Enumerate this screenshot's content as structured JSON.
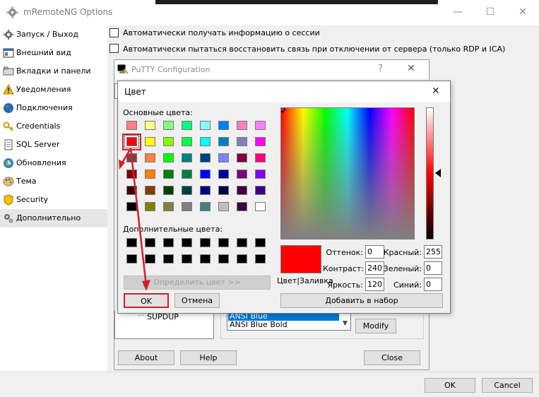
{
  "main": {
    "title": "mRemoteNG Options",
    "minimize": "—",
    "maximize": "☐",
    "close": "✕",
    "ok_label": "OK",
    "cancel_label": "Cancel"
  },
  "sidebar": {
    "items": [
      {
        "label": "Запуск / Выход",
        "icon": "gear-icon"
      },
      {
        "label": "Внешний вид",
        "icon": "window-icon"
      },
      {
        "label": "Вкладки и панели",
        "icon": "tabs-icon"
      },
      {
        "label": "Уведомления",
        "icon": "warning-icon"
      },
      {
        "label": "Подключения",
        "icon": "globe-icon"
      },
      {
        "label": "Credentials",
        "icon": "key-icon"
      },
      {
        "label": "SQL Server",
        "icon": "document-icon"
      },
      {
        "label": "Обновления",
        "icon": "update-icon"
      },
      {
        "label": "Тема",
        "icon": "palette-icon"
      },
      {
        "label": "Security",
        "icon": "shield-icon"
      },
      {
        "label": "Дополнительно",
        "icon": "gears-icon"
      }
    ]
  },
  "content": {
    "check1": "Автоматически получать информацию о сессии",
    "check2": "Автоматически пытаться восстановить связь при отключении от сервера (только RDP и ICA)"
  },
  "putty": {
    "title": "PuTTY Configuration",
    "help": "?",
    "close": "✕",
    "tree_item": "SUPDUP",
    "list_items": [
      "ANSI Blue",
      "ANSI Blue Bold"
    ],
    "modify_label": "Modify",
    "about_label": "About",
    "help_label": "Help",
    "close_label": "Close"
  },
  "color_dialog": {
    "title": "Цвет",
    "close": "✕",
    "basic_label": "Основные цвета:",
    "custom_label": "Дополнительные цвета:",
    "define_label": "Определить цвет >>",
    "ok_label": "OK",
    "cancel_label": "Отмена",
    "preview_label": "Цвет|Заливка",
    "add_label": "Добавить в набор",
    "hue_label": "Оттенок:",
    "hue_value": "0",
    "sat_label": "Контраст:",
    "sat_value": "240",
    "lum_label": "Яркость:",
    "lum_value": "120",
    "red_label": "Красный:",
    "red_value": "255",
    "green_label": "Зеленый:",
    "green_value": "0",
    "blue_label": "Синий:",
    "blue_value": "0",
    "selected_color": "#ff0000",
    "basic_colors": [
      [
        "#ff8080",
        "#ffff80",
        "#80ff80",
        "#00ff80",
        "#80ffff",
        "#0080ff",
        "#ff80c0",
        "#ff80ff"
      ],
      [
        "#ff0000",
        "#ffff00",
        "#80ff00",
        "#00ff40",
        "#00ffff",
        "#0080c0",
        "#8080c0",
        "#ff00ff"
      ],
      [
        "#804040",
        "#ff8040",
        "#00ff00",
        "#008080",
        "#004080",
        "#8080ff",
        "#800040",
        "#ff0080"
      ],
      [
        "#800000",
        "#ff8000",
        "#008000",
        "#008040",
        "#0000ff",
        "#0000a0",
        "#800080",
        "#8000ff"
      ],
      [
        "#400000",
        "#804000",
        "#004000",
        "#004040",
        "#000080",
        "#000040",
        "#400040",
        "#400080"
      ],
      [
        "#000000",
        "#808000",
        "#808040",
        "#808080",
        "#408080",
        "#c0c0c0",
        "#400040",
        "#ffffff"
      ]
    ]
  }
}
